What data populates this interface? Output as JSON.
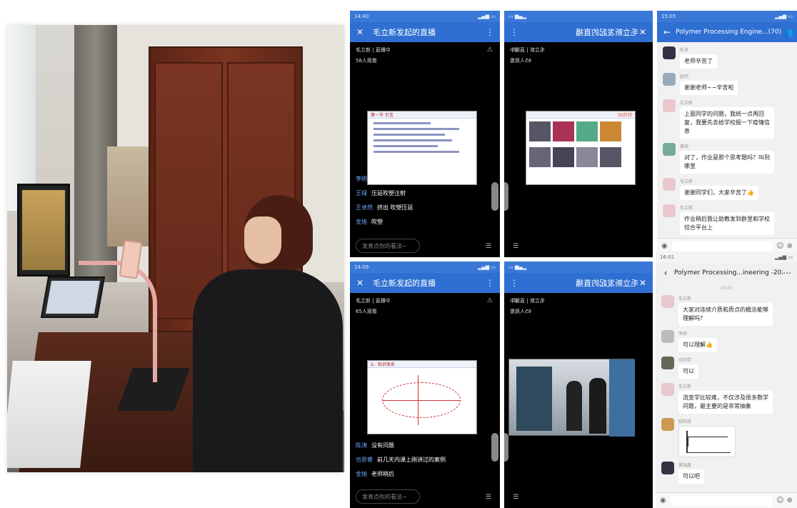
{
  "colors": {
    "blue_bar": "#2f6fd2",
    "link_blue": "#6ea7ff",
    "chat_bg": "#f1f1f1"
  },
  "photo": {
    "description_icon": "photo-icon"
  },
  "live1": {
    "status_time": "14:40",
    "title": "毛立新发起的直播",
    "host_status": "毛立新 | 直播中",
    "viewers": "58人观看",
    "slide_heading": "第一节 引言",
    "comments": [
      {
        "name": "李明",
        "text": "插入挂缸注射"
      },
      {
        "name": "王禄",
        "text": "压延吹塑注射"
      },
      {
        "name": "王卓然",
        "text": "挤出 吹塑压延"
      },
      {
        "name": "金旭",
        "text": "吹塑"
      }
    ],
    "input_placeholder": "发表点你的看法~"
  },
  "live2": {
    "title": "毛立新发起的直播",
    "host_status": "毛立新 | 直播中",
    "viewers": "65人观看",
    "slide_heading": "3D打印"
  },
  "chat1": {
    "status_time": "15:05",
    "title": "Polymer Processing Engine...(70)",
    "messages": [
      {
        "name": "陈涛",
        "text": "老师辛苦了"
      },
      {
        "name": "欧旸",
        "text": "谢谢老师~~辛苦啦"
      },
      {
        "name": "毛立新",
        "text": "上面同学的问题，我统一点再回复，我要先去给学校报一下疫情信息"
      },
      {
        "name": "黄硕",
        "text": "对了，作业是那个思考题吗？叫到哪里"
      },
      {
        "name": "毛立新",
        "text": "谢谢同学们，大家辛苦了👍"
      },
      {
        "name": "毛立新",
        "text": "作业稍后我让助教发到群里和学校综合平台上"
      }
    ]
  },
  "live3": {
    "status_time": "14:09",
    "title": "毛立新发起的直播",
    "host_status": "毛立新 | 直播中",
    "viewers": "65人观看",
    "slide_heading": "2、知识体系",
    "comments": [
      {
        "name": "陈涛",
        "text": "没有问题"
      },
      {
        "name": "也思睿",
        "text": "前几天内课上刚讲过的案例"
      },
      {
        "name": "金旭",
        "text": "老师稍后"
      }
    ],
    "input_placeholder": "发表点你的看法~"
  },
  "live4": {
    "title": "毛立新发起的直播",
    "host_status": "毛立新 | 直播中",
    "viewers": "65人观看"
  },
  "chat2": {
    "status_time": "16:01",
    "title": "Polymer Processing...ineering -2020(71)",
    "timestamp": "16:00",
    "messages": [
      {
        "name": "毛立新",
        "text": "大家对连续介质和质点的概念能够理解吗？"
      },
      {
        "name": "李硕",
        "text": "可以理解👍"
      },
      {
        "name": "邓同学",
        "text": "可以"
      },
      {
        "name": "毛立新",
        "text": "流变学比较难，不仅涉及很多数学问题，最主要的是非常抽象"
      },
      {
        "name": "欧阳旭",
        "text": ""
      },
      {
        "name": "黄瑞鑫",
        "text": "可以吧"
      }
    ]
  }
}
